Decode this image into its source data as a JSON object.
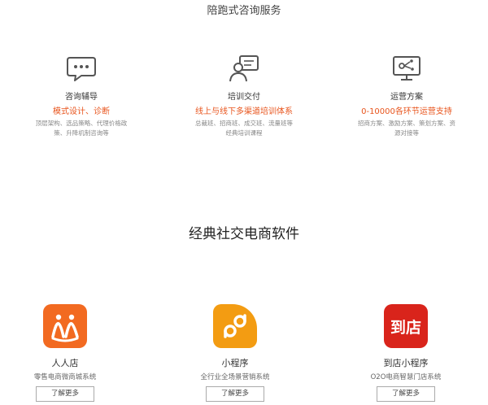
{
  "page": {
    "section1_title": "陪跑式咨询服务",
    "section2_title": "经典社交电商软件"
  },
  "services": [
    {
      "icon": "consulting-chat-icon",
      "name": "咨询辅导",
      "highlight": "模式设计、诊断",
      "desc": "顶层架构、选品策略、代理价格政策、升降机制咨询等"
    },
    {
      "icon": "training-person-icon",
      "name": "培训交付",
      "highlight": "线上与线下多渠道培训体系",
      "desc": "总裁班、招商班、成交班、流量班等经典培训课程"
    },
    {
      "icon": "operation-presentation-icon",
      "name": "运营方案",
      "highlight": "0-10000各环节运营支持",
      "desc": "招商方案、激励方案、策划方案、资源对接等"
    }
  ],
  "products": [
    {
      "icon": "renrendian-logo-icon",
      "name": "人人店",
      "desc": "零售电商微商城系统",
      "button": "了解更多"
    },
    {
      "icon": "mini-program-logo-icon",
      "name": "小程序",
      "desc": "全行业全场景营销系统",
      "button": "了解更多"
    },
    {
      "icon": "daodian-logo-icon",
      "name": "到店小程序",
      "desc": "O2O电商智慧门店系统",
      "button": "了解更多",
      "logo_text": "到店"
    }
  ],
  "colors": {
    "accent": "#e8541c",
    "renrendian": "#f26a21",
    "mini_program": "#f39c12",
    "daodian": "#d9241b"
  }
}
